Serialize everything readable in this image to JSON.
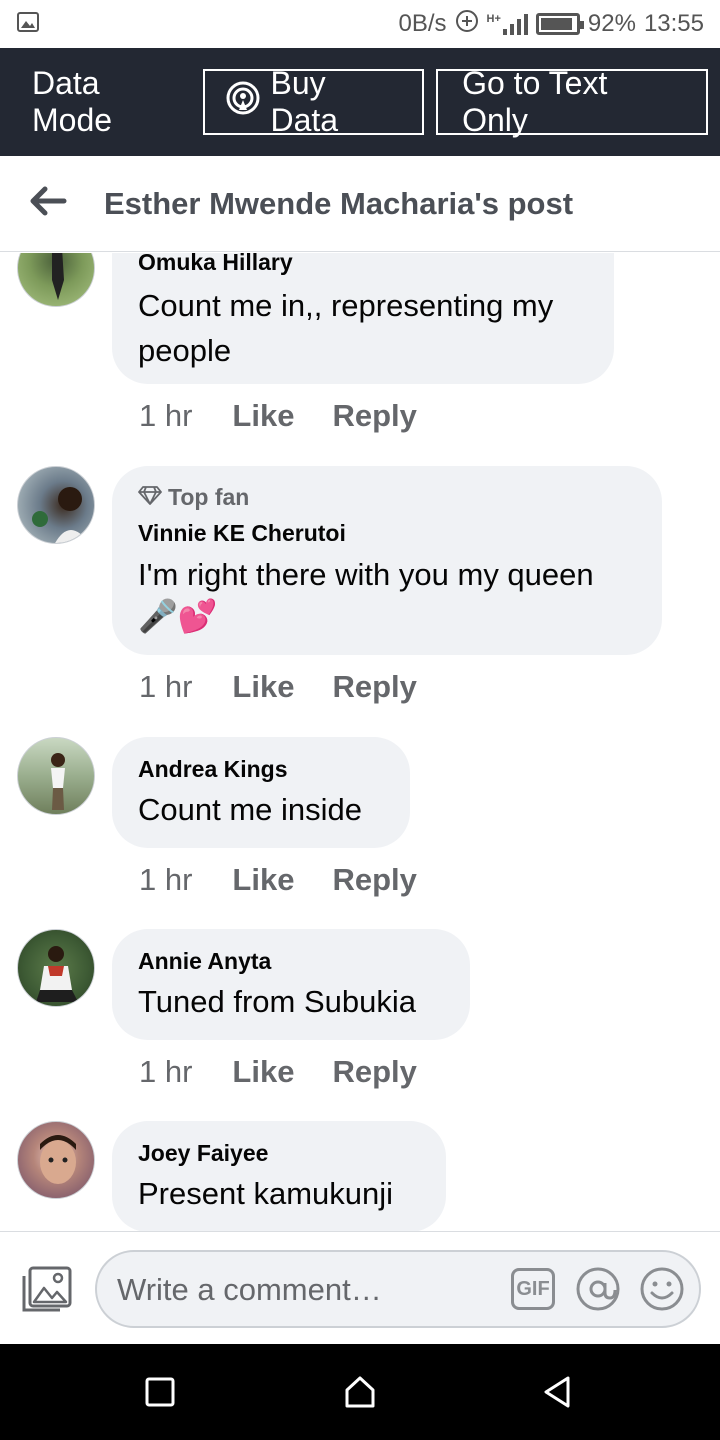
{
  "status_bar": {
    "speed": "0B/s",
    "network": "H+",
    "battery": "92%",
    "battery_level": 0.92,
    "time": "13:55"
  },
  "data_bar": {
    "label": "Data Mode",
    "buy_data": "Buy Data",
    "text_only": "Go to Text Only"
  },
  "header": {
    "title": "Esther Mwende Macharia's post"
  },
  "comments": [
    {
      "author": "Omuka Hillary",
      "text_lines": [
        "Count me in,, representing my",
        "people"
      ],
      "time": "1 hr",
      "like": "Like",
      "reply": "Reply"
    },
    {
      "badge": "Top fan",
      "author": "Vinnie KE Cherutoi",
      "text_lines": [
        "I'm right there with you my queen",
        "🎤💕"
      ],
      "time": "1 hr",
      "like": "Like",
      "reply": "Reply"
    },
    {
      "author": "Andrea Kings",
      "text_lines": [
        "Count me inside"
      ],
      "time": "1 hr",
      "like": "Like",
      "reply": "Reply"
    },
    {
      "author": "Annie Anyta",
      "text_lines": [
        "Tuned from Subukia"
      ],
      "time": "1 hr",
      "like": "Like",
      "reply": "Reply"
    },
    {
      "author": "Joey Faiyee",
      "text_lines": [
        "Present kamukunji"
      ]
    }
  ],
  "composer": {
    "placeholder": "Write a comment…",
    "gif": "GIF"
  }
}
